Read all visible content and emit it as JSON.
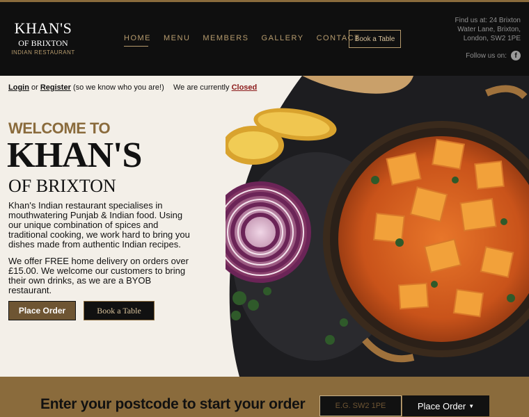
{
  "header": {
    "logo": {
      "main": "KHAN'S",
      "sub": "OF BRIXTON",
      "tag": "INDIAN RESTAURANT"
    },
    "nav": [
      {
        "label": "HOME",
        "active": true
      },
      {
        "label": "MENU",
        "active": false
      },
      {
        "label": "MEMBERS",
        "active": false
      },
      {
        "label": "GALLERY",
        "active": false
      },
      {
        "label": "CONTACT",
        "active": false
      }
    ],
    "book_button": "Book a Table",
    "find_us": "Find us at: 24 Brixton Water Lane, Brixton, London, SW2 1PE",
    "follow_us": "Follow us on:",
    "social_icon": "facebook-icon"
  },
  "hero": {
    "login": "Login",
    "or": "or",
    "register": "Register",
    "login_suffix": "(so we know who you are!)",
    "status_prefix": "We are currently",
    "status": "Closed",
    "welcome": "WELCOME TO",
    "title": "KHAN'S",
    "subtitle": "OF BRIXTON",
    "paragraph1": "Khan's Indian restaurant specialises in mouthwatering Punjab & Indian food. Using our unique combination of spices and traditional cooking, we work hard to bring you dishes made from authentic Indian recipes.",
    "paragraph2": "We offer FREE home delivery on orders over £15.00. We welcome our customers to bring their own drinks, as we are a BYOB restaurant.",
    "place_order": "Place Order",
    "book_table": "Book a Table"
  },
  "postcode": {
    "title": "Enter your postcode to start your order",
    "placeholder": "E.G. SW2 1PE",
    "button": "Place Order"
  },
  "colors": {
    "accent": "#8a6b3c",
    "header_bg": "#0f0f0f",
    "page_bg": "#f3efe8",
    "status_closed": "#8b1a1a"
  }
}
